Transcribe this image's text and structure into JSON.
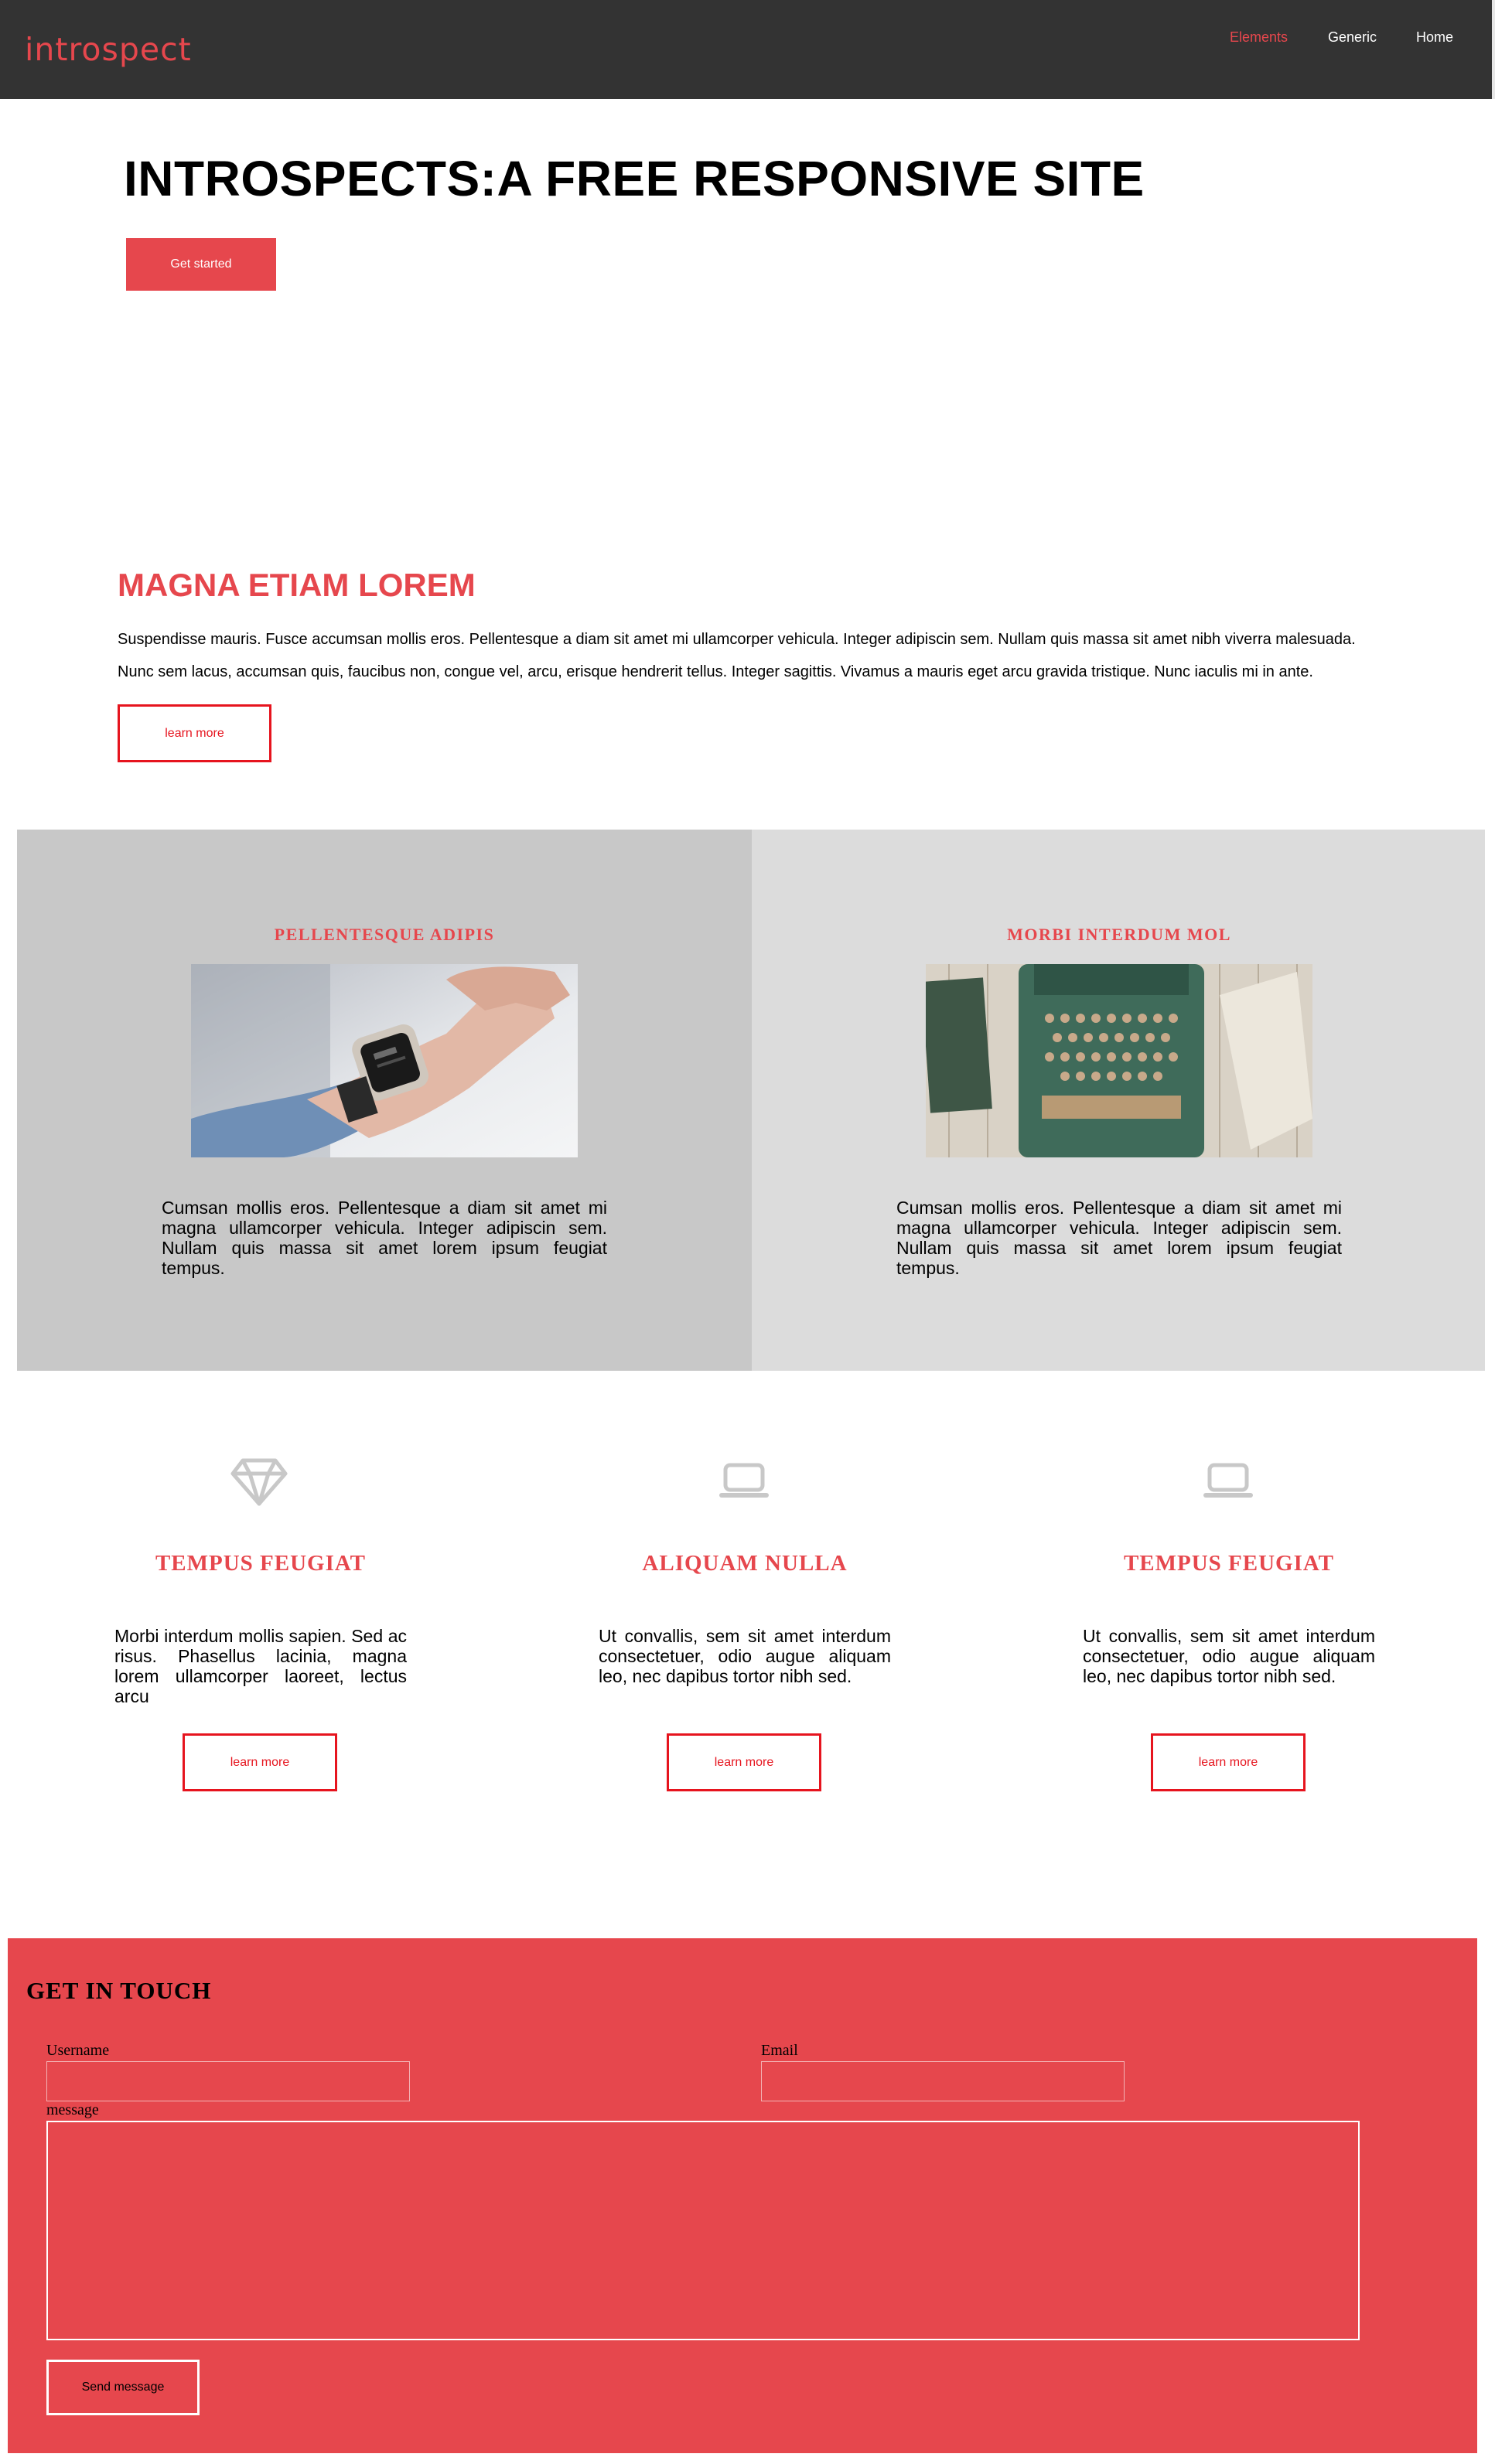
{
  "header": {
    "logo": "introspect",
    "nav": [
      {
        "label": "Elements",
        "active": true
      },
      {
        "label": "Generic",
        "active": false
      },
      {
        "label": "Home",
        "active": false
      }
    ]
  },
  "hero": {
    "title": "INTROSPECTS:A FREE RESPONSIVE SITE",
    "button": "Get started"
  },
  "intro": {
    "title": "MAGNA ETIAM LOREM",
    "paragraphs": [
      "Suspendisse mauris. Fusce accumsan mollis eros. Pellentesque a diam sit amet mi ullamcorper vehicula. Integer adipiscin sem. Nullam quis massa sit amet nibh viverra malesuada.",
      "Nunc sem lacus, accumsan quis, faucibus non, congue vel, arcu, erisque hendrerit tellus. Integer sagittis. Vivamus a mauris eget arcu gravida tristique. Nunc iaculis mi in ante."
    ],
    "button": "learn more"
  },
  "spotlights": [
    {
      "title": "PELLENTESQUE ADIPIS",
      "image": "smartwatch-photo",
      "text": "Cumsan mollis eros. Pellentesque a diam sit amet mi magna ullamcorper vehicula. Integer adipiscin sem. Nullam quis massa sit amet lorem ipsum feugiat tempus."
    },
    {
      "title": "MORBI INTERDUM MOL",
      "image": "typewriter-photo",
      "text": "Cumsan mollis eros. Pellentesque a diam sit amet mi magna ullamcorper vehicula. Integer adipiscin sem. Nullam quis massa sit amet lorem ipsum feugiat tempus."
    }
  ],
  "features": [
    {
      "icon": "diamond-icon",
      "title": "TEMPUS FEUGIAT",
      "text": "Morbi interdum mollis sapien. Sed ac risus. Phasellus lacinia, magna lorem ullamcorper laoreet, lectus arcu",
      "button": "learn more"
    },
    {
      "icon": "laptop-icon",
      "title": "ALIQUAM NULLA",
      "text": "Ut convallis, sem sit amet interdum consectetuer, odio augue aliquam leo, nec dapibus tortor nibh sed.",
      "button": "learn more"
    },
    {
      "icon": "laptop-icon",
      "title": "TEMPUS FEUGIAT",
      "text": "Ut convallis, sem sit amet interdum consectetuer, odio augue aliquam leo, nec dapibus tortor nibh sed.",
      "button": "learn more"
    }
  ],
  "contact": {
    "title": "GET IN TOUCH",
    "username_label": "Username",
    "username_value": "",
    "email_label": "Email",
    "email_value": "",
    "message_label": "message",
    "message_value": "",
    "button": "Send message"
  },
  "colors": {
    "accent": "#e6474d",
    "header_bg": "#333333",
    "outline_red": "#e6141e",
    "panel_left": "#c8c8c8",
    "panel_right": "#dcdcdc",
    "icon_gray": "#c8c8c8"
  }
}
